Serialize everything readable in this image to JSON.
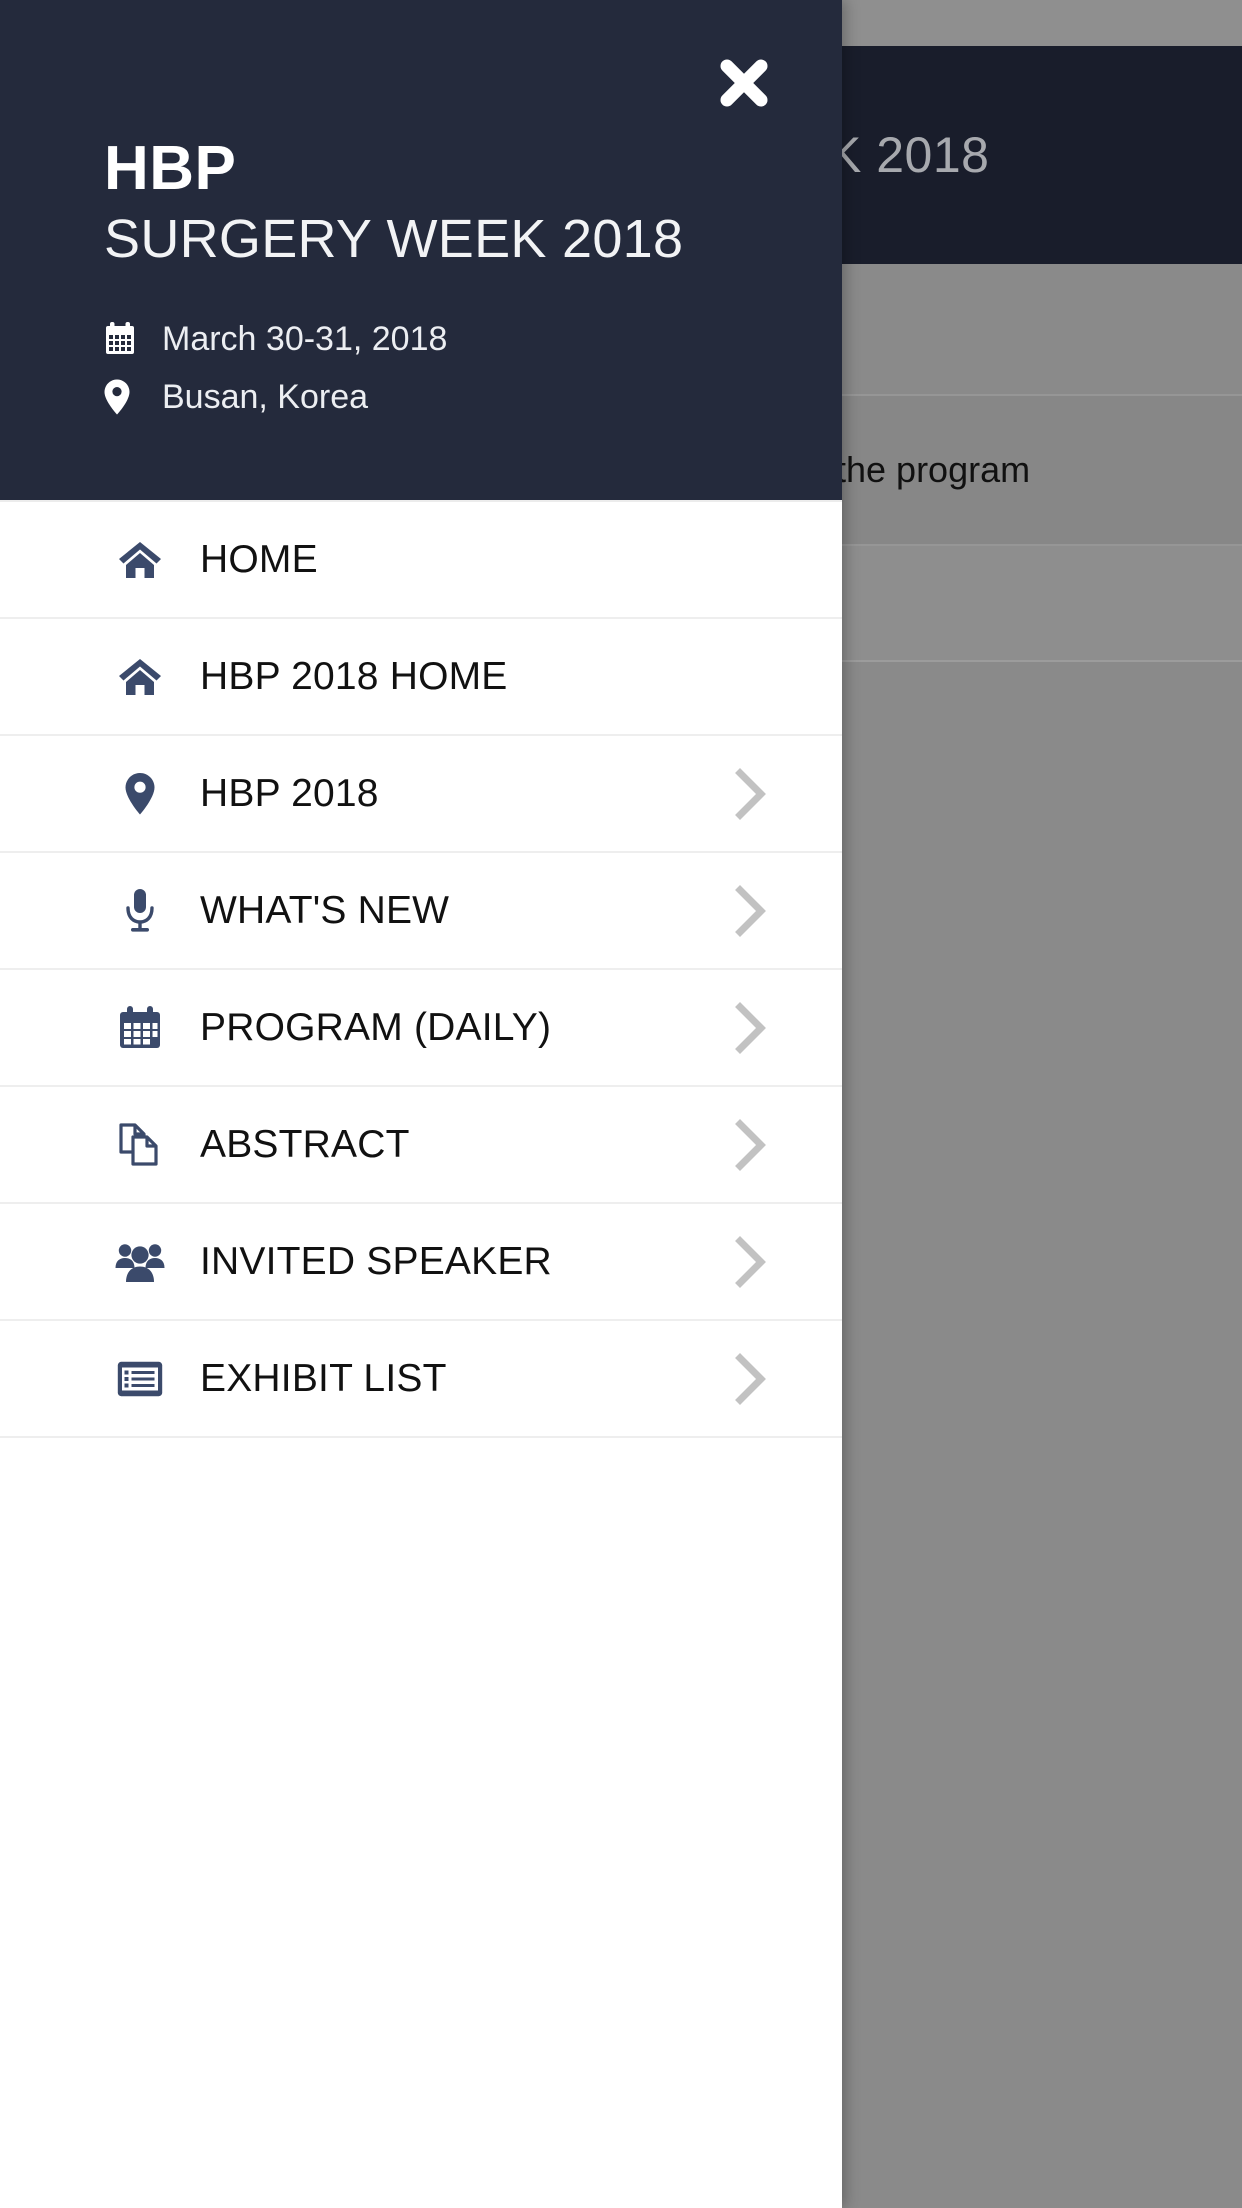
{
  "background": {
    "hero_title": "K 2018",
    "program_text": "the program"
  },
  "drawer": {
    "close_icon": "close-icon",
    "brand": {
      "abbr": "HBP",
      "full_title": "SURGERY WEEK 2018"
    },
    "meta": [
      {
        "icon": "calendar-icon",
        "text": "March 30-31, 2018"
      },
      {
        "icon": "map-pin-icon",
        "text": "Busan, Korea"
      }
    ],
    "menu_items": [
      {
        "icon": "home-icon",
        "label": "HOME",
        "has_chevron": false
      },
      {
        "icon": "home-icon",
        "label": "HBP 2018 HOME",
        "has_chevron": false
      },
      {
        "icon": "map-pin-icon",
        "label": "HBP 2018",
        "has_chevron": true
      },
      {
        "icon": "microphone-icon",
        "label": "WHAT'S NEW",
        "has_chevron": true
      },
      {
        "icon": "calendar-icon",
        "label": "PROGRAM (DAILY)",
        "has_chevron": true
      },
      {
        "icon": "copy-docs-icon",
        "label": "ABSTRACT",
        "has_chevron": true
      },
      {
        "icon": "users-group-icon",
        "label": "INVITED SPEAKER",
        "has_chevron": true
      },
      {
        "icon": "list-alt-icon",
        "label": "EXHIBIT LIST",
        "has_chevron": true
      }
    ]
  },
  "colors": {
    "panel_dark": "#242a3c",
    "icon_blue": "#3b4a6b",
    "chevron_gray": "#c2c2c2",
    "overlay_gray": "#8a8a8a",
    "hero_dark": "#191d2b"
  }
}
